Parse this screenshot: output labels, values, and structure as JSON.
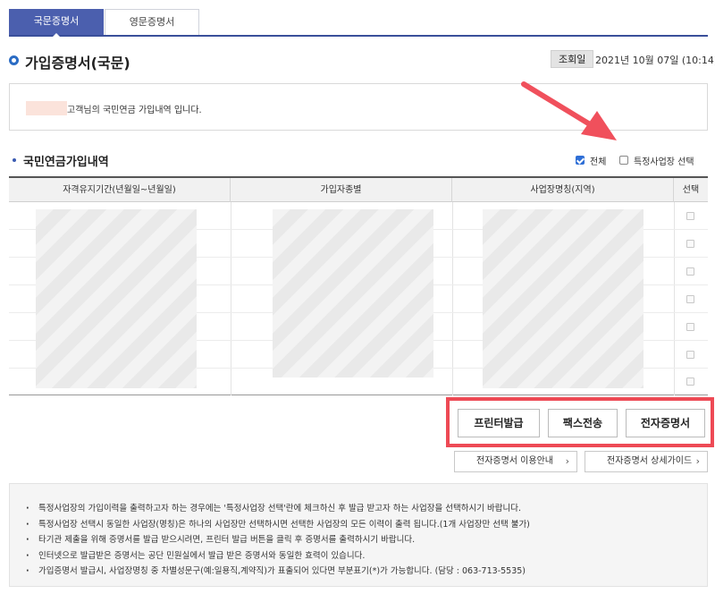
{
  "tabs": [
    {
      "label": "국문증명서",
      "active": true
    },
    {
      "label": "영문증명서",
      "active": false
    }
  ],
  "header": {
    "title": "가입증명서(국문)",
    "view_date_label": "조회일",
    "view_date": "2021년 10월 07일 (10:14)"
  },
  "notice": {
    "text": "고객님의 국민연금 가입내역 입니다."
  },
  "section": {
    "title": "국민연금가입내역",
    "all_label": "전체",
    "all_checked": true,
    "specific_label": "특정사업장 선택",
    "specific_checked": false
  },
  "table": {
    "columns": [
      "자격유지기간(년월일~년월일)",
      "가입자종별",
      "사업장명칭(지역)",
      "선택"
    ],
    "row_count": 7
  },
  "actions": {
    "print_label": "프린터발급",
    "fax_label": "팩스전송",
    "ecert_label": "전자증명서"
  },
  "links": {
    "ecert_guide_label": "전자증명서 이용안내",
    "ecert_detail_label": "전자증명서 상세가이드",
    "chevron": "›"
  },
  "info": [
    "특정사업장의 가입이력을 출력하고자 하는 경우에는 '특정사업장 선택'란에 체크하신 후 발급 받고자 하는 사업장을 선택하시기 바랍니다.",
    "특정사업장 선택시 동일한 사업장(명칭)은 하나의 사업장만 선택하시면 선택한 사업장의 모든 이력이 출력 됩니다.(1개 사업장만 선택 불가)",
    "타기관 제출을 위해 증명서를 발급 받으시려면, 프린터 발급 버튼을 클릭 후 증명서를 출력하시기 바랍니다.",
    "인터넷으로 발급받은 증명서는 공단 민원실에서 발급 받은 증명서와 동일한 효력이 있습니다.",
    "가입증명서 발급시, 사업장명칭 중 차별성문구(예:일용직,계약직)가 표출되어 있다면 부분표기(*)가 가능합니다. (담당 : 063-713-5535)"
  ],
  "colors": {
    "tab_active": "#4b5fae",
    "highlight": "#ee4a55",
    "accent": "#2b6cc4"
  }
}
